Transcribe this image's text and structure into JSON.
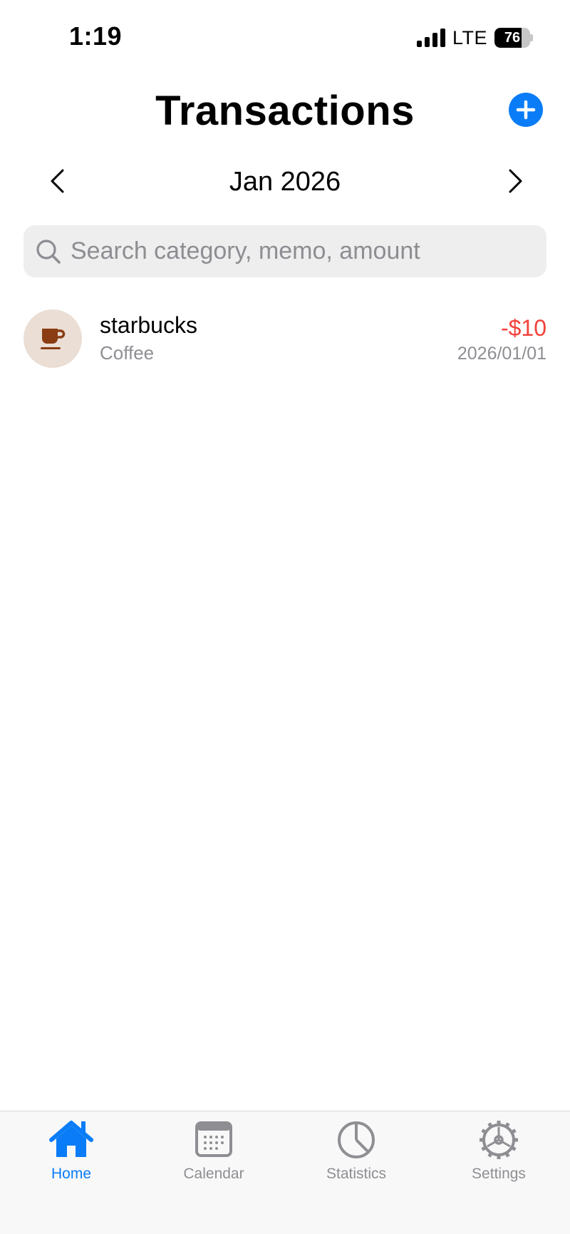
{
  "status": {
    "time": "1:19",
    "network": "LTE",
    "battery": "76",
    "battery_level": 0.76
  },
  "header": {
    "title": "Transactions",
    "add_icon": "plus-circle-icon"
  },
  "month_nav": {
    "label": "Jan 2026",
    "prev_icon": "chevron-left-icon",
    "next_icon": "chevron-right-icon"
  },
  "search": {
    "placeholder": "Search category, memo, amount",
    "value": ""
  },
  "transactions": [
    {
      "name": "starbucks",
      "category": "Coffee",
      "amount": "-$10",
      "date": "2026/01/01",
      "icon": "coffee-cup-icon",
      "amount_color": "#f2413a",
      "icon_bg": "#eaded5",
      "icon_color": "#8a3c12"
    }
  ],
  "tabs": [
    {
      "label": "Home",
      "icon": "house-icon",
      "active": true
    },
    {
      "label": "Calendar",
      "icon": "calendar-icon",
      "active": false
    },
    {
      "label": "Statistics",
      "icon": "pie-chart-icon",
      "active": false
    },
    {
      "label": "Settings",
      "icon": "gear-icon",
      "active": false
    }
  ],
  "colors": {
    "accent": "#0a7cf7",
    "inactive": "#8e8e93",
    "expense": "#f2413a"
  }
}
